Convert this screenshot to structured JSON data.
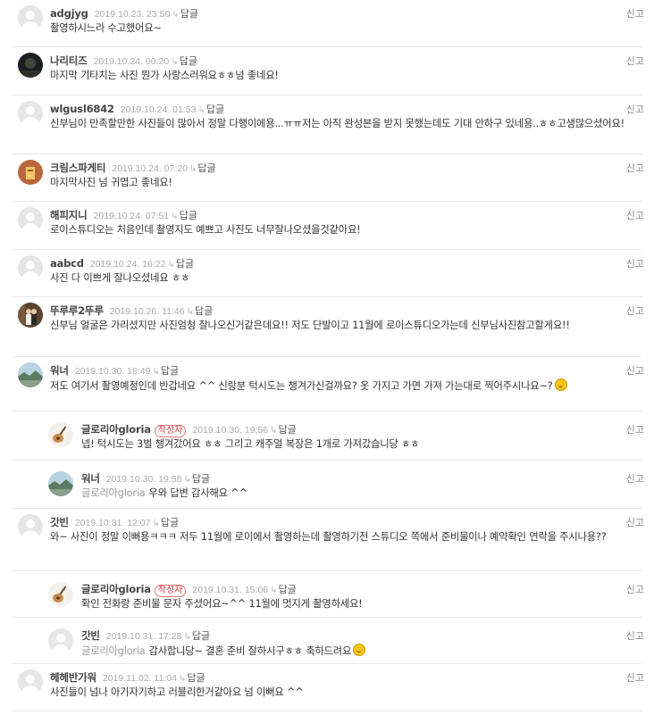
{
  "labels": {
    "reply": "답글",
    "report": "신고",
    "author_badge": "작성자"
  },
  "colors": {
    "author_badge": "#d53a3a",
    "reply_line": "#e6a07a"
  },
  "comments": [
    {
      "name": "adgjyg",
      "date": "2019.10.23. 23:50",
      "text": "촬영하시느라 수고했어요~",
      "avatar": "default-avatar-icon"
    },
    {
      "name": "나리티즈",
      "date": "2019.10.24. 00:20",
      "text": "마지막 기타치는 사진 뭔가 사랑스러워요ㅎㅎ넘 좋네요!",
      "avatar": "dark-photo-avatar"
    },
    {
      "name": "wlgusl6842",
      "date": "2019.10.24. 01:53",
      "text": "신부님이 만족할만한 사진들이 많아서 정말 다행이에용...ㅠㅠ저는 아직 완성본을 받지 못했는데도 기대 안하구 있네용..ㅎㅎ고생많으셨어요!",
      "avatar": "default-avatar-icon"
    },
    {
      "name": "크림스파게티",
      "date": "2019.10.24. 07:20",
      "text": "마지막사진 넘 귀엽고 좋네요!",
      "avatar": "pasta-photo-avatar"
    },
    {
      "name": "해피지니",
      "date": "2019.10.24. 07:51",
      "text": "로이스튜디오는 처음인데 촬영지도 예쁘고 사진도 너무잘나오셨을것같아요!",
      "avatar": "default-avatar-icon"
    },
    {
      "name": "aabcd",
      "date": "2019.10.24. 16:22",
      "text": "사진 다 이쁘게 잘나오셨네요 ㅎㅎ",
      "avatar": "default-avatar-icon"
    },
    {
      "name": "뚜루루2뚜루",
      "date": "2019.10.26. 11:46",
      "text": "신부님 얼굴은 가리셨지만 사진엄청 잘나오신거같은데요!! 저도 단발이고 11월에 로이스튜디오가는데 신부님사진참고할게요!!",
      "avatar": "couple-photo-avatar"
    },
    {
      "name": "워너",
      "date": "2019.10.30. 18:49",
      "text": "저도 여기서 촬영예정인데 반갑네요 ^^ 신랑분 턱시도는 챙겨가신걸까요? 옷 가지고 가면 가져 가는대로 찍어주시나요~?",
      "emoji": true,
      "avatar": "landscape-photo-avatar"
    },
    {
      "name": "글로리아gloria",
      "author": true,
      "date": "2019.10.30. 19:56",
      "text": "넵! 턱시도는 3벌 챙겨갔어요 ㅎㅎ 그리고 캐주얼 복장은 1개로 가져갔습니당 ㅎㅎ",
      "avatar": "guitar-avatar",
      "is_reply": true
    },
    {
      "name": "워너",
      "date": "2019.10.30. 19:58",
      "mention": "글로리아gloria",
      "text": "우와 답변 감사해요 ^^",
      "avatar": "landscape-photo-avatar",
      "is_reply": true
    },
    {
      "name": "갓빈",
      "date": "2019.10.31. 12:07",
      "text": "와~ 사진이 정말 이뻐용ㅋㅋㅋ 저두 11월에 로이에서 촬영하는데 촬영하기전 스튜디오 쪽에서 준비물이나 예약확인 연락을 주시나용??",
      "avatar": "default-avatar-icon"
    },
    {
      "name": "글로리아gloria",
      "author": true,
      "date": "2019.10.31. 15:06",
      "text": "확인 전화랑 준비물 문자 주셨어요~^^ 11월에 멋지게 촬영하세요!",
      "avatar": "guitar-avatar",
      "is_reply": true
    },
    {
      "name": "갓빈",
      "date": "2019.10.31. 17:28",
      "mention": "글로리아gloria",
      "text": "감사합니당~ 결혼 준비 잘하시구ㅎㅎ 축하드려요",
      "emoji": true,
      "avatar": "default-avatar-icon",
      "is_reply": true
    },
    {
      "name": "헤헤반가워",
      "date": "2019.11.02. 11:04",
      "text": "사진들이 넘나 아기자기하고 러블리한거같아요 넘 이뻐요 ^^",
      "avatar": "default-avatar-icon"
    }
  ]
}
